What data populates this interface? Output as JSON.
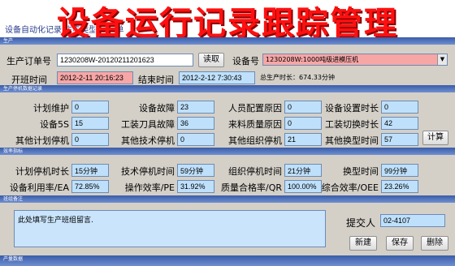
{
  "banner": {
    "title": "设备运行记录跟踪管理",
    "subtitle": "设备自动化记录   生产类型   生产单"
  },
  "strips": {
    "header_top": "生产",
    "downtime": "生产停机数据记录",
    "indicators": "效率指标",
    "comment": "班组备注",
    "bottom": "产量数据"
  },
  "order": {
    "label": "生产订单号",
    "value": "1230208W-20120211201623",
    "read_button": "读取",
    "device_label": "设备号",
    "device_value": "1230208W:1000吨级进模压机"
  },
  "shift": {
    "start_label": "开班时间",
    "start_value": "2012-2-11 20:16:23",
    "end_label": "结束时间",
    "end_value": "2012-2-12 7:30:43",
    "total": "总生产时长：674.33分钟"
  },
  "downtime": {
    "rows": [
      [
        {
          "label": "计划维护",
          "value": "0"
        },
        {
          "label": "设备故障",
          "value": "23"
        },
        {
          "label": "人员配置原因",
          "value": "0"
        },
        {
          "label": "设备设置时长",
          "value": "0"
        }
      ],
      [
        {
          "label": "设备5S",
          "value": "15"
        },
        {
          "label": "工装刀具故障",
          "value": "36"
        },
        {
          "label": "来料质量原因",
          "value": "0"
        },
        {
          "label": "工装切换时长",
          "value": "42"
        }
      ],
      [
        {
          "label": "其他计划停机",
          "value": "0"
        },
        {
          "label": "其他技术停机",
          "value": "0"
        },
        {
          "label": "其他组织停机",
          "value": "21"
        },
        {
          "label": "其他换型时间",
          "value": "57"
        }
      ]
    ],
    "calc_button": "计算"
  },
  "indicators": {
    "rows": [
      [
        {
          "label": "计划停机时长",
          "value": "15分钟"
        },
        {
          "label": "技术停机时间",
          "value": "59分钟"
        },
        {
          "label": "组织停机时间",
          "value": "21分钟"
        },
        {
          "label": "换型时间",
          "value": "99分钟"
        }
      ],
      [
        {
          "label": "设备利用率/EA",
          "value": "72.85%"
        },
        {
          "label": "操作效率/PE",
          "value": "31.92%"
        },
        {
          "label": "质量合格率/QR",
          "value": "100.00%"
        },
        {
          "label": "综合效率/OEE",
          "value": "23.26%"
        }
      ]
    ]
  },
  "comment": {
    "text": "此处填写生产班组留言.",
    "submitter_label": "提交人",
    "submitter_value": "02-4107",
    "new_button": "新建",
    "save_button": "保存",
    "delete_button": "删除"
  },
  "colors": {
    "title_red": "#ff1010",
    "strip_blue": "#3a5ca8",
    "field_blue": "#c9e4fb",
    "field_pink": "#f7a6a6"
  }
}
